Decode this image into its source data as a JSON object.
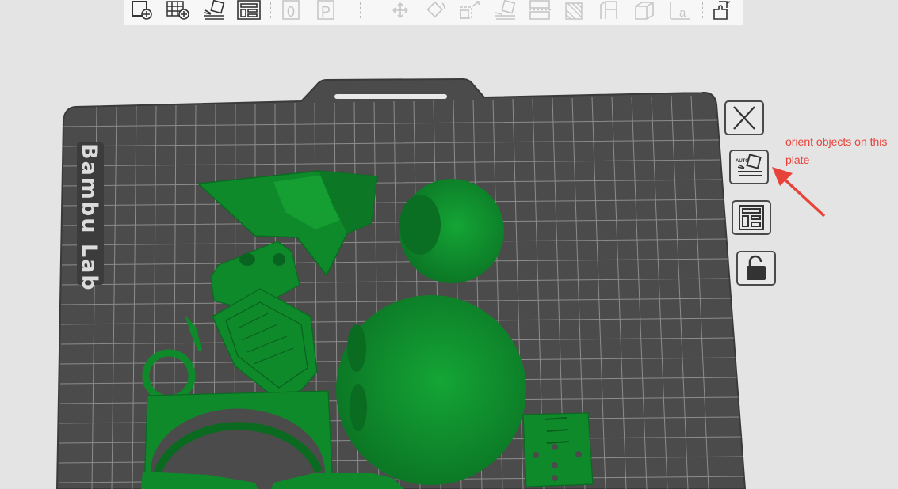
{
  "toolbar": {
    "buttons": [
      {
        "name": "add-plate-icon",
        "enabled": true
      },
      {
        "name": "arrange-grid-icon",
        "enabled": true
      },
      {
        "name": "auto-orient-icon",
        "enabled": true
      },
      {
        "name": "layout-plate-icon",
        "enabled": true
      },
      {
        "name": "object-zero-icon",
        "enabled": false
      },
      {
        "name": "part-p-icon",
        "enabled": false
      },
      {
        "name": "move-icon",
        "enabled": false
      },
      {
        "name": "rotate-icon",
        "enabled": false
      },
      {
        "name": "scale-icon",
        "enabled": false
      },
      {
        "name": "lay-on-face-icon",
        "enabled": false
      },
      {
        "name": "cut-icon",
        "enabled": false
      },
      {
        "name": "support-paint-icon",
        "enabled": false
      },
      {
        "name": "seam-paint-icon",
        "enabled": false
      },
      {
        "name": "boolean-icon",
        "enabled": false
      },
      {
        "name": "text-icon",
        "enabled": false
      },
      {
        "name": "assembly-icon",
        "enabled": true
      }
    ],
    "zero_glyph": "0",
    "p_glyph": "P",
    "a_glyph": "a"
  },
  "plate": {
    "brand": "Bambu Lab",
    "bed_color": "#4a4a4a",
    "grid_color": "#8e8e8e",
    "model_color": "#118c2c"
  },
  "plate_controls": [
    {
      "name": "close-plate-icon"
    },
    {
      "name": "auto-orient-plate-icon",
      "label": "AUTO"
    },
    {
      "name": "arrange-plate-icon"
    },
    {
      "name": "lock-plate-icon"
    }
  ],
  "annotation": {
    "text": "orient objects on this plate",
    "color": "#e8433a"
  }
}
